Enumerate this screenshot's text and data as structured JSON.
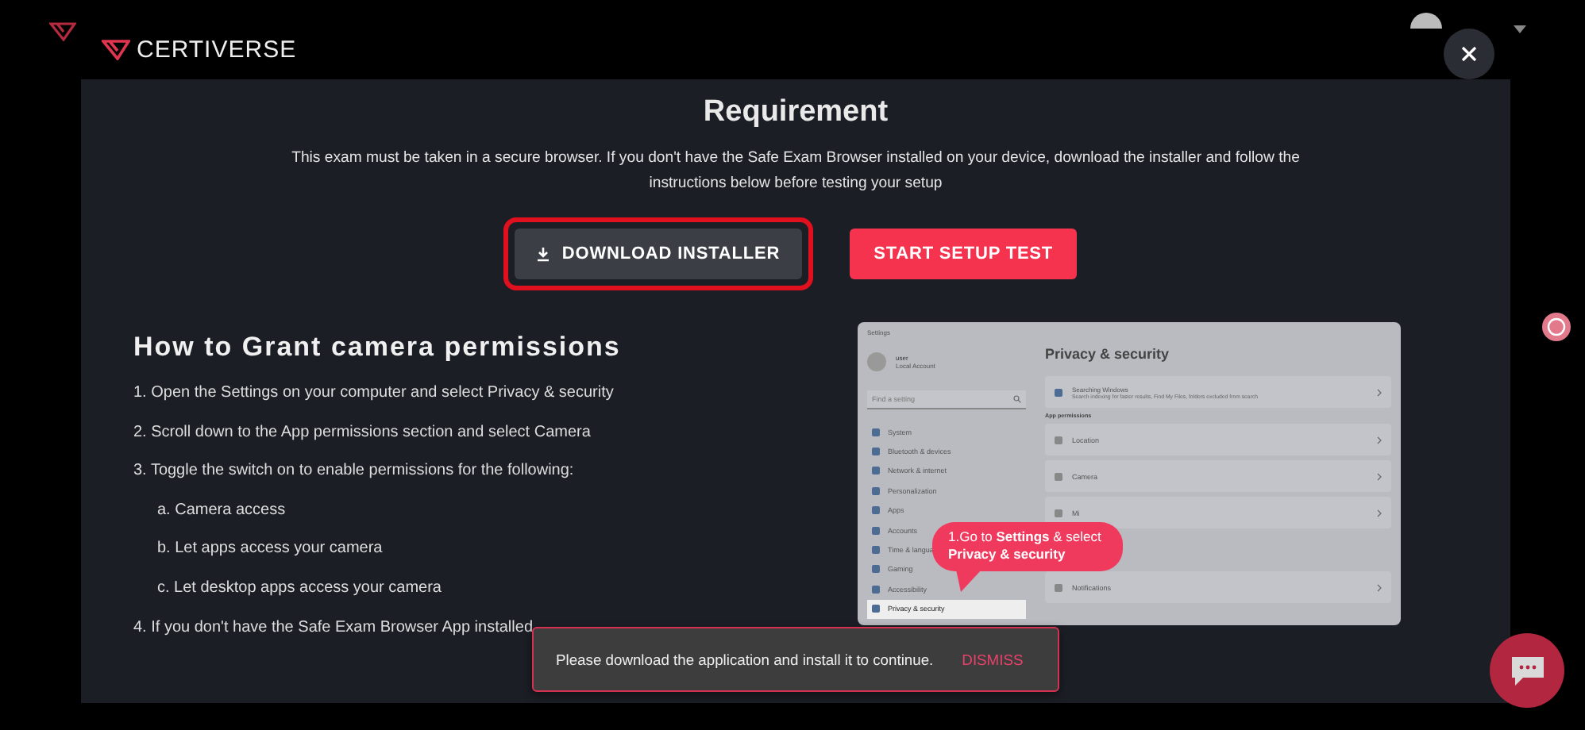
{
  "brand": {
    "name": "CERTIVERSE"
  },
  "modal": {
    "title": "Requirement",
    "description": "This exam must be taken in a secure browser. If you don't have the Safe Exam Browser installed on your device, download the installer and follow the instructions below before testing your setup",
    "buttons": [
      {
        "label": "DOWNLOAD INSTALLER",
        "kind": "download",
        "highlighted": true
      },
      {
        "label": "START SETUP TEST",
        "kind": "primary",
        "highlighted": false
      }
    ],
    "section_title": "How to Grant camera permissions",
    "steps": [
      {
        "text": "1. Open the Settings on your computer and select Privacy & security"
      },
      {
        "text": "2. Scroll down to the App permissions section and select Camera"
      },
      {
        "text": "3. Toggle the switch on to enable permissions for the following:",
        "children": [
          {
            "text": "a. Camera access"
          },
          {
            "text": "b. Let apps access your camera"
          },
          {
            "text": "c. Let desktop apps access your camera"
          }
        ]
      },
      {
        "text": "4. If you don't have the Safe Exam Browser App installed"
      }
    ],
    "screenshot": {
      "window_title": "Settings",
      "user_name": "user",
      "account_type": "Local Account",
      "search_placeholder": "Find a setting",
      "sidebar": [
        {
          "label": "System",
          "selected": false
        },
        {
          "label": "Bluetooth & devices",
          "selected": false
        },
        {
          "label": "Network & internet",
          "selected": false
        },
        {
          "label": "Personalization",
          "selected": false
        },
        {
          "label": "Apps",
          "selected": false
        },
        {
          "label": "Accounts",
          "selected": false
        },
        {
          "label": "Time & langua",
          "selected": false
        },
        {
          "label": "Gaming",
          "selected": false
        },
        {
          "label": "Accessibility",
          "selected": false
        },
        {
          "label": "Privacy & security",
          "selected": true
        }
      ],
      "page_title": "Privacy & security",
      "top_card": {
        "title": "Searching Windows",
        "subtitle": "Search indexing for faster results, Find My Files, folders excluded from search"
      },
      "group_label": "App permissions",
      "rows": [
        {
          "label": "Location"
        },
        {
          "label": "Camera"
        },
        {
          "label": "Mi"
        },
        {
          "label": "Notifications"
        }
      ],
      "callout": "1.Go to **Settings** & select **Privacy & security**"
    }
  },
  "toast": {
    "message": "Please download the application and install it to continue.",
    "action": "DISMISS"
  }
}
